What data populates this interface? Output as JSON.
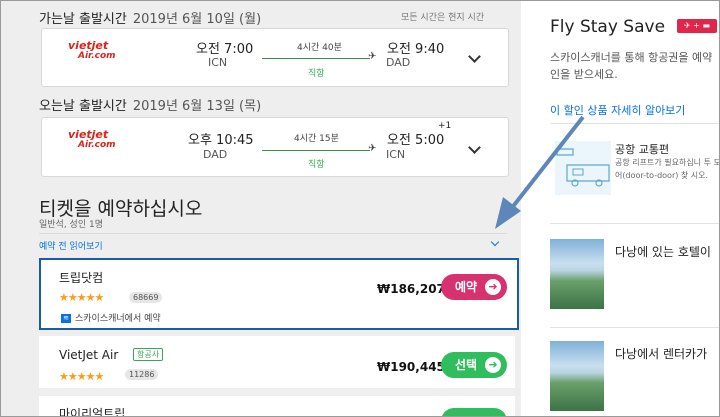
{
  "outbound": {
    "label": "가는날 출발시간",
    "date": "2019년 6월 10일 (월)",
    "timezone_note": "모든 시간은 현지 시간",
    "airline_logo": [
      "vietjet",
      "Air.com"
    ],
    "dep_time": "오전 7:00",
    "dep_code": "ICN",
    "duration": "4시간 40분",
    "stops": "직항",
    "arr_time": "오전 9:40",
    "arr_code": "DAD"
  },
  "return": {
    "label": "오는날 출발시간",
    "date": "2019년 6월 13일 (목)",
    "airline_logo": [
      "vietjet",
      "Air.com"
    ],
    "dep_time": "오후 10:45",
    "dep_code": "DAD",
    "duration": "4시간 15분",
    "stops": "직항",
    "arr_time": "오전 5:00",
    "arr_plus": "+1",
    "arr_code": "ICN"
  },
  "booking": {
    "title": "티켓을 예약하십시오",
    "subtitle": "일반석, 성인 1명",
    "read_before": "예약 전 읽어보기",
    "providers": [
      {
        "name": "트립닷컴",
        "stars": "★★★★★",
        "reviews": "68669",
        "price": "₩186,207",
        "button": "예약",
        "via": "스카이스캐너에서 예약"
      },
      {
        "name": "VietJet Air",
        "badge": "항공사",
        "stars": "★★★★★",
        "reviews": "11286",
        "price": "₩190,445",
        "button": "선택"
      },
      {
        "name": "마이리얼트립"
      }
    ]
  },
  "sidebar": {
    "title": "Fly Stay Save",
    "badge": "✈ + ▬",
    "desc": "스카이스캐너를 통해 항공권을 예약 인을 받으세요.",
    "link": "이 할인 상품 자세히 알아보기",
    "airport_title": "공항 교통편",
    "airport_desc": "공항 리프트가 필요하십니 투 도어(door-to-door) 찾 시오.",
    "hotel_title": "다낭에 있는 호텔이",
    "car_title": "다낭에서 렌터카가 "
  },
  "colors": {
    "accent": "#0770e3",
    "book_pink": "#d7316f",
    "select_green": "#2fbd5e",
    "highlight_border": "#1a5ba6",
    "arrow": "#5d87b8"
  }
}
